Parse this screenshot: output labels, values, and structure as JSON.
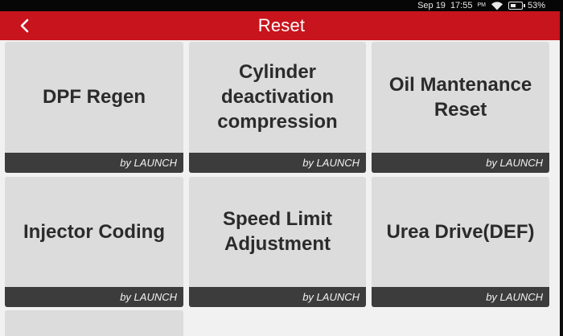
{
  "status_bar": {
    "date": "Sep 19",
    "time": "17:55",
    "ampm": "PM",
    "battery": "53%"
  },
  "header": {
    "title": "Reset",
    "back_icon": "chevron-left-icon"
  },
  "tiles": [
    {
      "label": "DPF Regen",
      "vendor": "by LAUNCH"
    },
    {
      "label": "Cylinder deactivation compression",
      "vendor": "by LAUNCH"
    },
    {
      "label": "Oil Mantenance Reset",
      "vendor": "by LAUNCH"
    },
    {
      "label": "Injector Coding",
      "vendor": "by LAUNCH"
    },
    {
      "label": "Speed Limit Adjustment",
      "vendor": "by LAUNCH"
    },
    {
      "label": "Urea Drive(DEF)",
      "vendor": "by LAUNCH"
    },
    {
      "label": "",
      "vendor": ""
    }
  ],
  "colors": {
    "header": "#c8141c",
    "tile": "#dcdcdc",
    "tile_footer": "#3c3c3c"
  }
}
